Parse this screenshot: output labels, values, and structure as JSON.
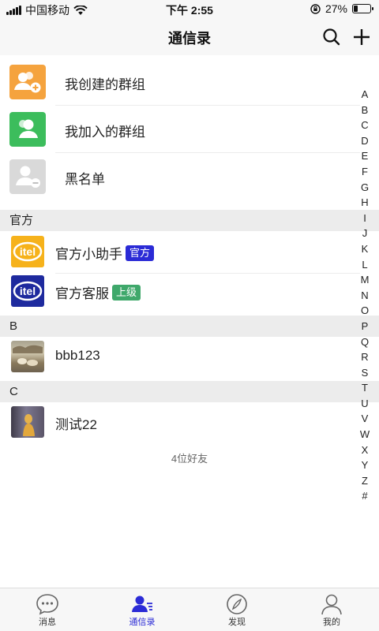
{
  "status_bar": {
    "carrier": "中国移动",
    "time": "下午 2:55",
    "battery": "27%",
    "battery_level": 0.27
  },
  "header": {
    "title": "通信录",
    "search_icon": "search-icon",
    "add_icon": "plus-icon"
  },
  "groups": [
    {
      "label": "我创建的群组",
      "icon": "group-add-icon",
      "color": "#f5a33e"
    },
    {
      "label": "我加入的群组",
      "icon": "group-icon",
      "color": "#3cbd5c"
    },
    {
      "label": "黑名单",
      "icon": "blacklist-icon",
      "color": "#d9d9d9"
    }
  ],
  "sections": [
    {
      "header": "官方",
      "contacts": [
        {
          "name": "官方小助手",
          "badge": "官方",
          "badge_color": "#2b2bd6",
          "avatar": "itel-logo-yellow"
        },
        {
          "name": "官方客服",
          "badge": "上级",
          "badge_color": "#3fa86b",
          "avatar": "itel-logo-blue"
        }
      ]
    },
    {
      "header": "B",
      "contacts": [
        {
          "name": "bbb123",
          "avatar": "photo-avatar"
        }
      ]
    },
    {
      "header": "C",
      "contacts": [
        {
          "name": "测试22",
          "avatar": "photo-avatar"
        }
      ]
    }
  ],
  "friend_count": "4位好友",
  "alphabet": [
    "A",
    "B",
    "C",
    "D",
    "E",
    "F",
    "G",
    "H",
    "I",
    "J",
    "K",
    "L",
    "M",
    "N",
    "O",
    "P",
    "Q",
    "R",
    "S",
    "T",
    "U",
    "V",
    "W",
    "X",
    "Y",
    "Z",
    "#"
  ],
  "bottom_nav": [
    {
      "label": "消息",
      "icon": "chat-bubble-icon",
      "active": false
    },
    {
      "label": "通信录",
      "icon": "contacts-icon",
      "active": true
    },
    {
      "label": "发现",
      "icon": "compass-icon",
      "active": false
    },
    {
      "label": "我的",
      "icon": "person-icon",
      "active": false
    }
  ],
  "colors": {
    "accent": "#2b2bd6",
    "section_bg": "#ececec",
    "header_bg": "#f7f7f7"
  }
}
